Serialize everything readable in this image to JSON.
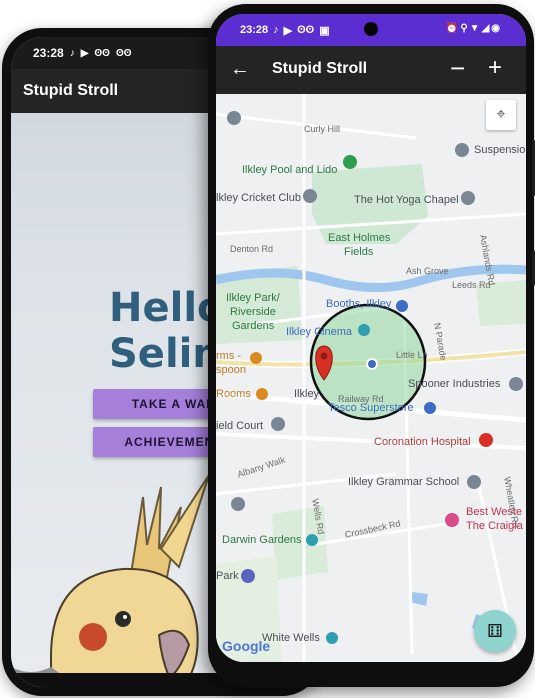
{
  "back_phone": {
    "status_time": "23:28",
    "status_icons": [
      "tiktok-icon",
      "youtube-icon",
      "owl-icon",
      "owl-icon"
    ],
    "app_title": "Stupid Stroll",
    "greeting_line1": "Hello",
    "greeting_line2": "Selim",
    "take_walk_label": "TAKE A WALK",
    "achievements_label": "ACHIEVEMENTS"
  },
  "front_phone": {
    "status_time": "23:28",
    "status_left_icons": [
      "tiktok-icon",
      "youtube-icon",
      "owl-icon",
      "image-icon"
    ],
    "status_right_icons": [
      "alarm-icon",
      "location-icon",
      "wifi-icon",
      "signal-icon",
      "battery-icon"
    ],
    "app_title": "Stupid Stroll",
    "zoom_out_label": "−",
    "zoom_in_label": "+",
    "google_logo": "Google",
    "map_places": {
      "curly_hill": "Curly Hill",
      "suspension": "Suspensio",
      "pool": "Ilkley Pool and Lido",
      "hot_yoga": "The Hot Yoga Chapel",
      "cricket": "lkley Cricket Club",
      "denton_rd": "Denton Rd",
      "east_holmes_1": "East Holmes",
      "east_holmes_2": "Fields",
      "ashlands": "Ashlands Rd",
      "ash_grove": "Ash Grove",
      "leeds_rd": "Leeds Rd",
      "ilkley_park_1": "Ilkley Park/",
      "ilkley_park_2": "Riverside",
      "ilkley_park_3": "Gardens",
      "booths": "Booths, Ilkley",
      "cinema": "Ilkley Cinema",
      "n_parade": "N Parade",
      "arms_1": "rms -",
      "arms_2": "spoon",
      "little_ln": "Little Ln",
      "spooner": "Spooner Industries",
      "rooms": "Rooms",
      "ilkley_station": "Ilkley",
      "railway_rd": "Railway Rd",
      "tesco": "Tesco Superstore",
      "field_court": "ield Court",
      "coronation": "Coronation Hospital",
      "albany": "Albany Walk",
      "grammar": "Ilkley Grammar School",
      "wheatley": "Wheatley Rd",
      "wells_rd": "Wells Rd",
      "best_western_1": "Best Weste",
      "best_western_2": "The Craigla",
      "crossbeck": "Crossbeck Rd",
      "darwin": "Darwin Gardens",
      "park": "Park",
      "white_wells": "White Wells"
    }
  },
  "colors": {
    "status_purple": "#5a2ed0",
    "appbar_dark": "#242424",
    "button_purple": "#a57fd9",
    "greeting_blue": "#2f5f7d",
    "park_green": "#c8e6c9",
    "river_blue": "#9fc6ee",
    "fab_teal": "#8ed3ce",
    "pin_red": "#d93025"
  }
}
